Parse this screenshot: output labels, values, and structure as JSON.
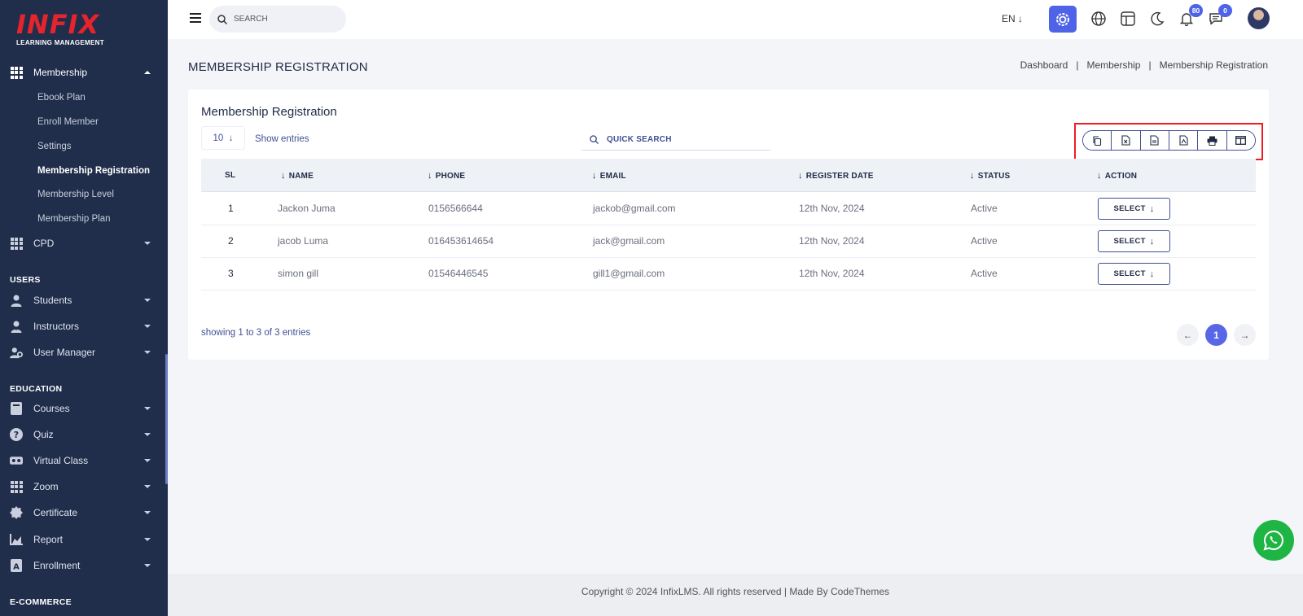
{
  "brand": {
    "logo": "INFIX",
    "tagline": "LEARNING MANAGEMENT"
  },
  "sidebar": {
    "membership": {
      "label": "Membership",
      "sub": [
        "Ebook Plan",
        "Enroll Member",
        "Settings",
        "Membership Registration",
        "Membership Level",
        "Membership Plan"
      ]
    },
    "cpd": "CPD",
    "users_heading": "USERS",
    "students": "Students",
    "instructors": "Instructors",
    "user_manager": "User Manager",
    "education_heading": "EDUCATION",
    "courses": "Courses",
    "quiz": "Quiz",
    "virtual_class": "Virtual Class",
    "zoom": "Zoom",
    "certificate": "Certificate",
    "report": "Report",
    "enrollment": "Enrollment",
    "ecommerce_heading": "E-COMMERCE"
  },
  "topbar": {
    "search_label": "SEARCH",
    "language": "EN",
    "notifications_count": "80",
    "messages_count": "0"
  },
  "page": {
    "title": "MEMBERSHIP REGISTRATION",
    "breadcrumb": [
      "Dashboard",
      "Membership",
      "Membership Registration"
    ]
  },
  "card": {
    "title": "Membership Registration",
    "entries_value": "10",
    "show_entries": "Show entries",
    "quick_search": "QUICK SEARCH",
    "columns": [
      "SL",
      "NAME",
      "PHONE",
      "EMAIL",
      "REGISTER DATE",
      "STATUS",
      "ACTION"
    ],
    "rows": [
      {
        "sl": "1",
        "name": "Jackon Juma",
        "phone": "0156566644",
        "email": "jackob@gmail.com",
        "date": "12th Nov, 2024",
        "status": "Active",
        "action": "SELECT"
      },
      {
        "sl": "2",
        "name": "jacob Luma",
        "phone": "016453614654",
        "email": "jack@gmail.com",
        "date": "12th Nov, 2024",
        "status": "Active",
        "action": "SELECT"
      },
      {
        "sl": "3",
        "name": "simon gill",
        "phone": "01546446545",
        "email": "gill1@gmail.com",
        "date": "12th Nov, 2024",
        "status": "Active",
        "action": "SELECT"
      }
    ],
    "showing": "showing 1 to 3 of 3 entries",
    "current_page": "1"
  },
  "footer": {
    "text": "Copyright © 2024 InfixLMS. All rights reserved | Made By CodeThemes"
  },
  "colors": {
    "sidebar_bg": "#202e4b",
    "accent": "#4f63e8",
    "highlight": "#ef1c24",
    "whatsapp": "#1fb544"
  }
}
